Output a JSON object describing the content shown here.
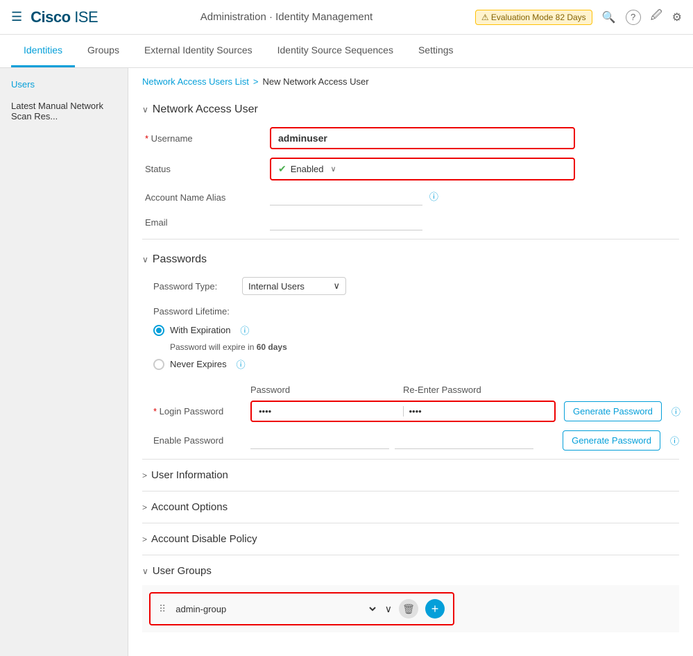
{
  "header": {
    "hamburger": "☰",
    "cisco_text": "Cisco",
    "ise_text": "ISE",
    "title": "Administration · Identity Management",
    "eval_badge": "⚠ Evaluation Mode 82 Days",
    "icons": {
      "search": "🔍",
      "help": "?",
      "notifications": "🔔",
      "settings": "⚙"
    }
  },
  "nav_tabs": [
    {
      "label": "Identities",
      "active": true
    },
    {
      "label": "Groups",
      "active": false
    },
    {
      "label": "External Identity Sources",
      "active": false
    },
    {
      "label": "Identity Source Sequences",
      "active": false
    },
    {
      "label": "Settings",
      "active": false
    }
  ],
  "sidebar": {
    "items": [
      {
        "label": "Users",
        "active": true
      },
      {
        "label": "Latest Manual Network Scan Res...",
        "active": false
      }
    ]
  },
  "breadcrumb": {
    "link": "Network Access Users List",
    "separator": ">",
    "current": "New Network Access User"
  },
  "form": {
    "section_title": "Network Access User",
    "section_toggle": "∨",
    "username_label": "Username",
    "username_value": "adminuser",
    "status_label": "Status",
    "status_check": "✔",
    "status_value": "Enabled",
    "status_chevron": "∨",
    "account_name_alias_label": "Account Name Alias",
    "email_label": "Email"
  },
  "passwords": {
    "section_title": "Passwords",
    "section_toggle": "∨",
    "type_label": "Password Type:",
    "type_value": "Internal Users",
    "type_chevron": "∨",
    "lifetime_label": "Password Lifetime:",
    "with_expiration_label": "With Expiration",
    "expiry_note": "Password will expire in",
    "expiry_days": "60 days",
    "never_expires_label": "Never Expires",
    "col_password": "Password",
    "col_reenter": "Re-Enter Password",
    "login_password_label": "Login Password",
    "login_password_dots": "••••",
    "login_reenter_dots": "••••",
    "generate_btn_1": "Generate Password",
    "enable_password_label": "Enable Password",
    "generate_btn_2": "Generate Password"
  },
  "user_information": {
    "label": "User Information",
    "toggle": ">"
  },
  "account_options": {
    "label": "Account Options",
    "toggle": ">"
  },
  "account_disable": {
    "label": "Account Disable Policy",
    "toggle": ">"
  },
  "user_groups": {
    "label": "User Groups",
    "toggle": "∨",
    "group_value": "admin-group",
    "drag_handle": "⠿",
    "chevron": "∨",
    "delete_icon": "🗑",
    "add_icon": "+"
  }
}
